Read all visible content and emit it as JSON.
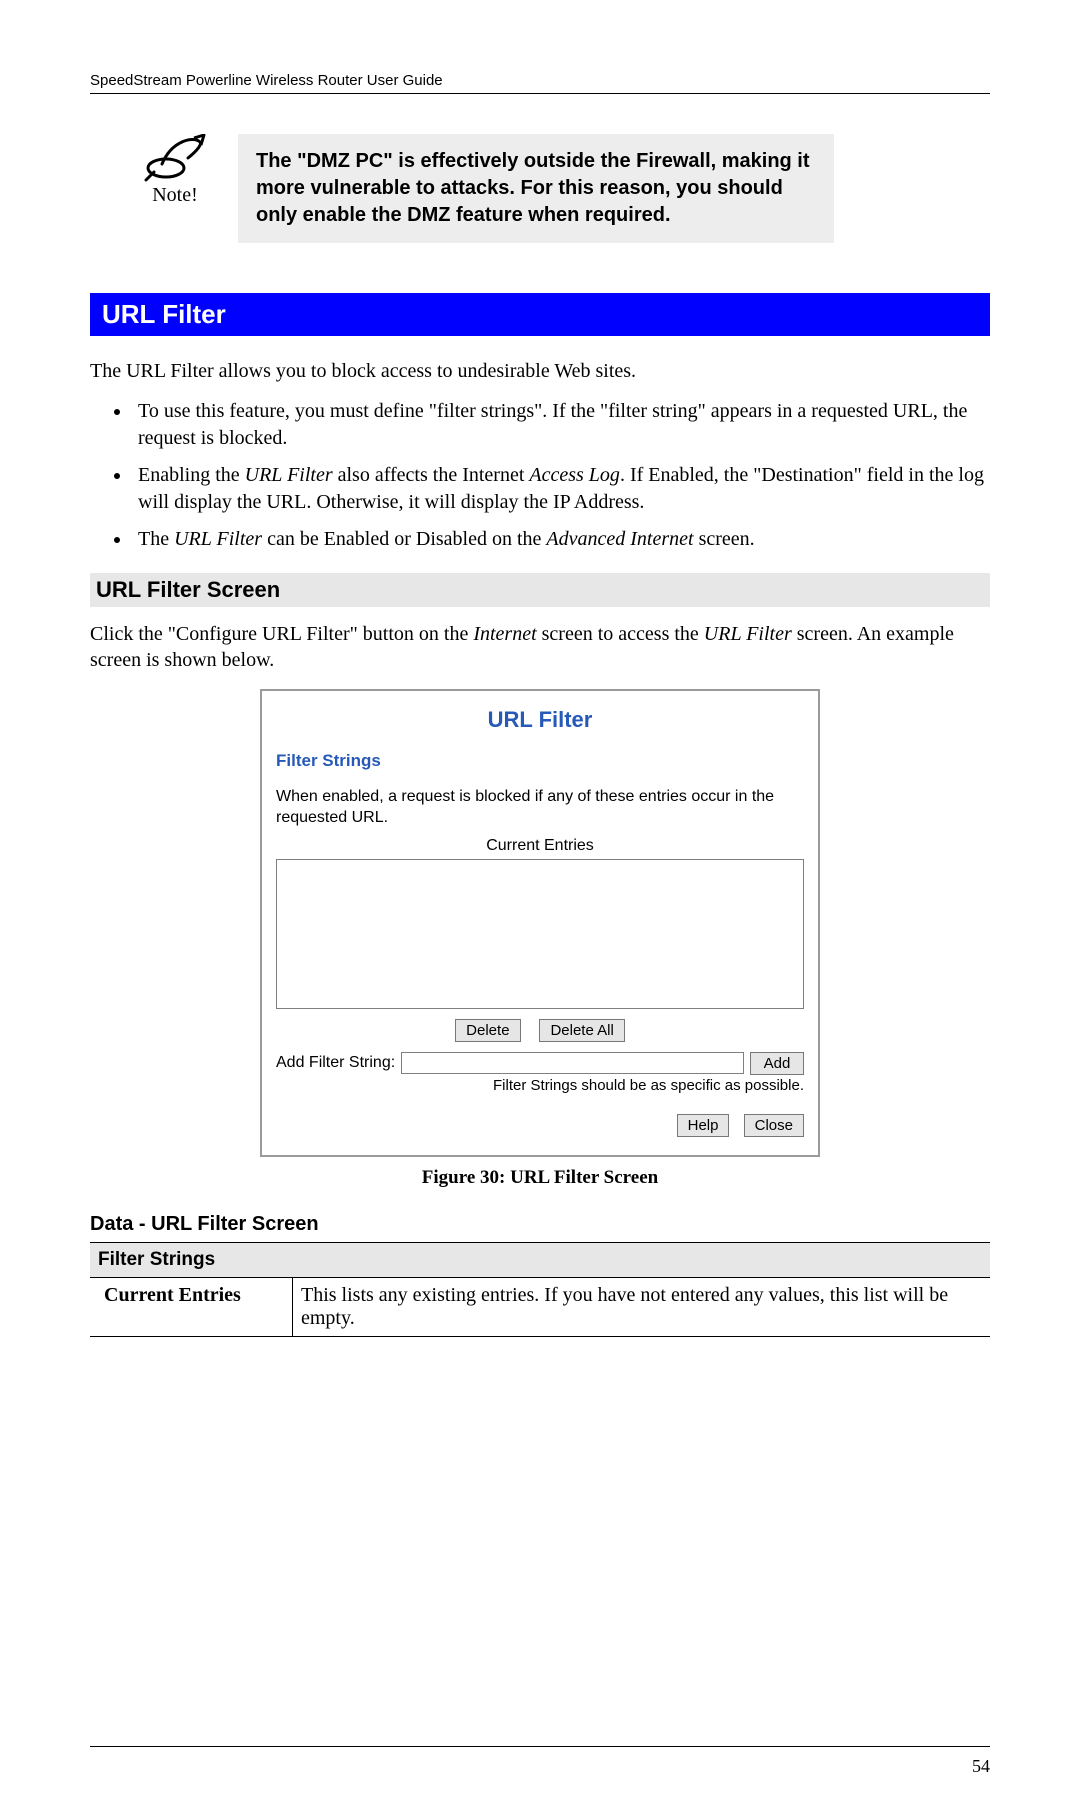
{
  "header": {
    "running_head": "SpeedStream Powerline Wireless Router User Guide"
  },
  "note": {
    "icon_label": "Note!",
    "text": "The \"DMZ PC\" is effectively outside the Firewall, making it more vulnerable to attacks. For this reason, you should only enable the DMZ feature when required."
  },
  "section": {
    "title": "URL Filter",
    "intro": "The URL Filter allows you to block access to undesirable Web sites.",
    "bullets": {
      "b1": "To use this feature, you must define \"filter strings\". If the \"filter string\" appears in a requested URL, the request is blocked.",
      "b2_a": "Enabling the ",
      "b2_b": "URL Filter",
      "b2_c": " also affects the Internet ",
      "b2_d": "Access Log",
      "b2_e": ". If Enabled, the \"Destination\" field in the log will display the URL. Otherwise, it will display the IP Address.",
      "b3_a": "The ",
      "b3_b": "URL Filter",
      "b3_c": " can be Enabled or Disabled on the ",
      "b3_d": "Advanced Internet",
      "b3_e": " screen."
    }
  },
  "subsection": {
    "title": "URL Filter Screen",
    "para_a": "Click the \"Configure URL Filter\" button on the ",
    "para_b": "Internet",
    "para_c": " screen to access the ",
    "para_d": "URL Filter",
    "para_e": " screen. An example screen is shown below."
  },
  "ui": {
    "title": "URL Filter",
    "sub": "Filter Strings",
    "desc": "When enabled, a request is blocked if any of these entries occur in the requested URL.",
    "current_entries_label": "Current Entries",
    "delete_btn": "Delete",
    "delete_all_btn": "Delete All",
    "add_label": "Add Filter String:",
    "add_btn": "Add",
    "hint": "Filter Strings should be as specific as possible.",
    "help_btn": "Help",
    "close_btn": "Close"
  },
  "figure": {
    "caption": "Figure 30: URL Filter Screen"
  },
  "data_table": {
    "heading": "Data - URL Filter Screen",
    "section": "Filter Strings",
    "row1_label": "Current Entries",
    "row1_value": "This lists any existing entries. If you have not entered any values, this list will be empty."
  },
  "page_number": "54"
}
